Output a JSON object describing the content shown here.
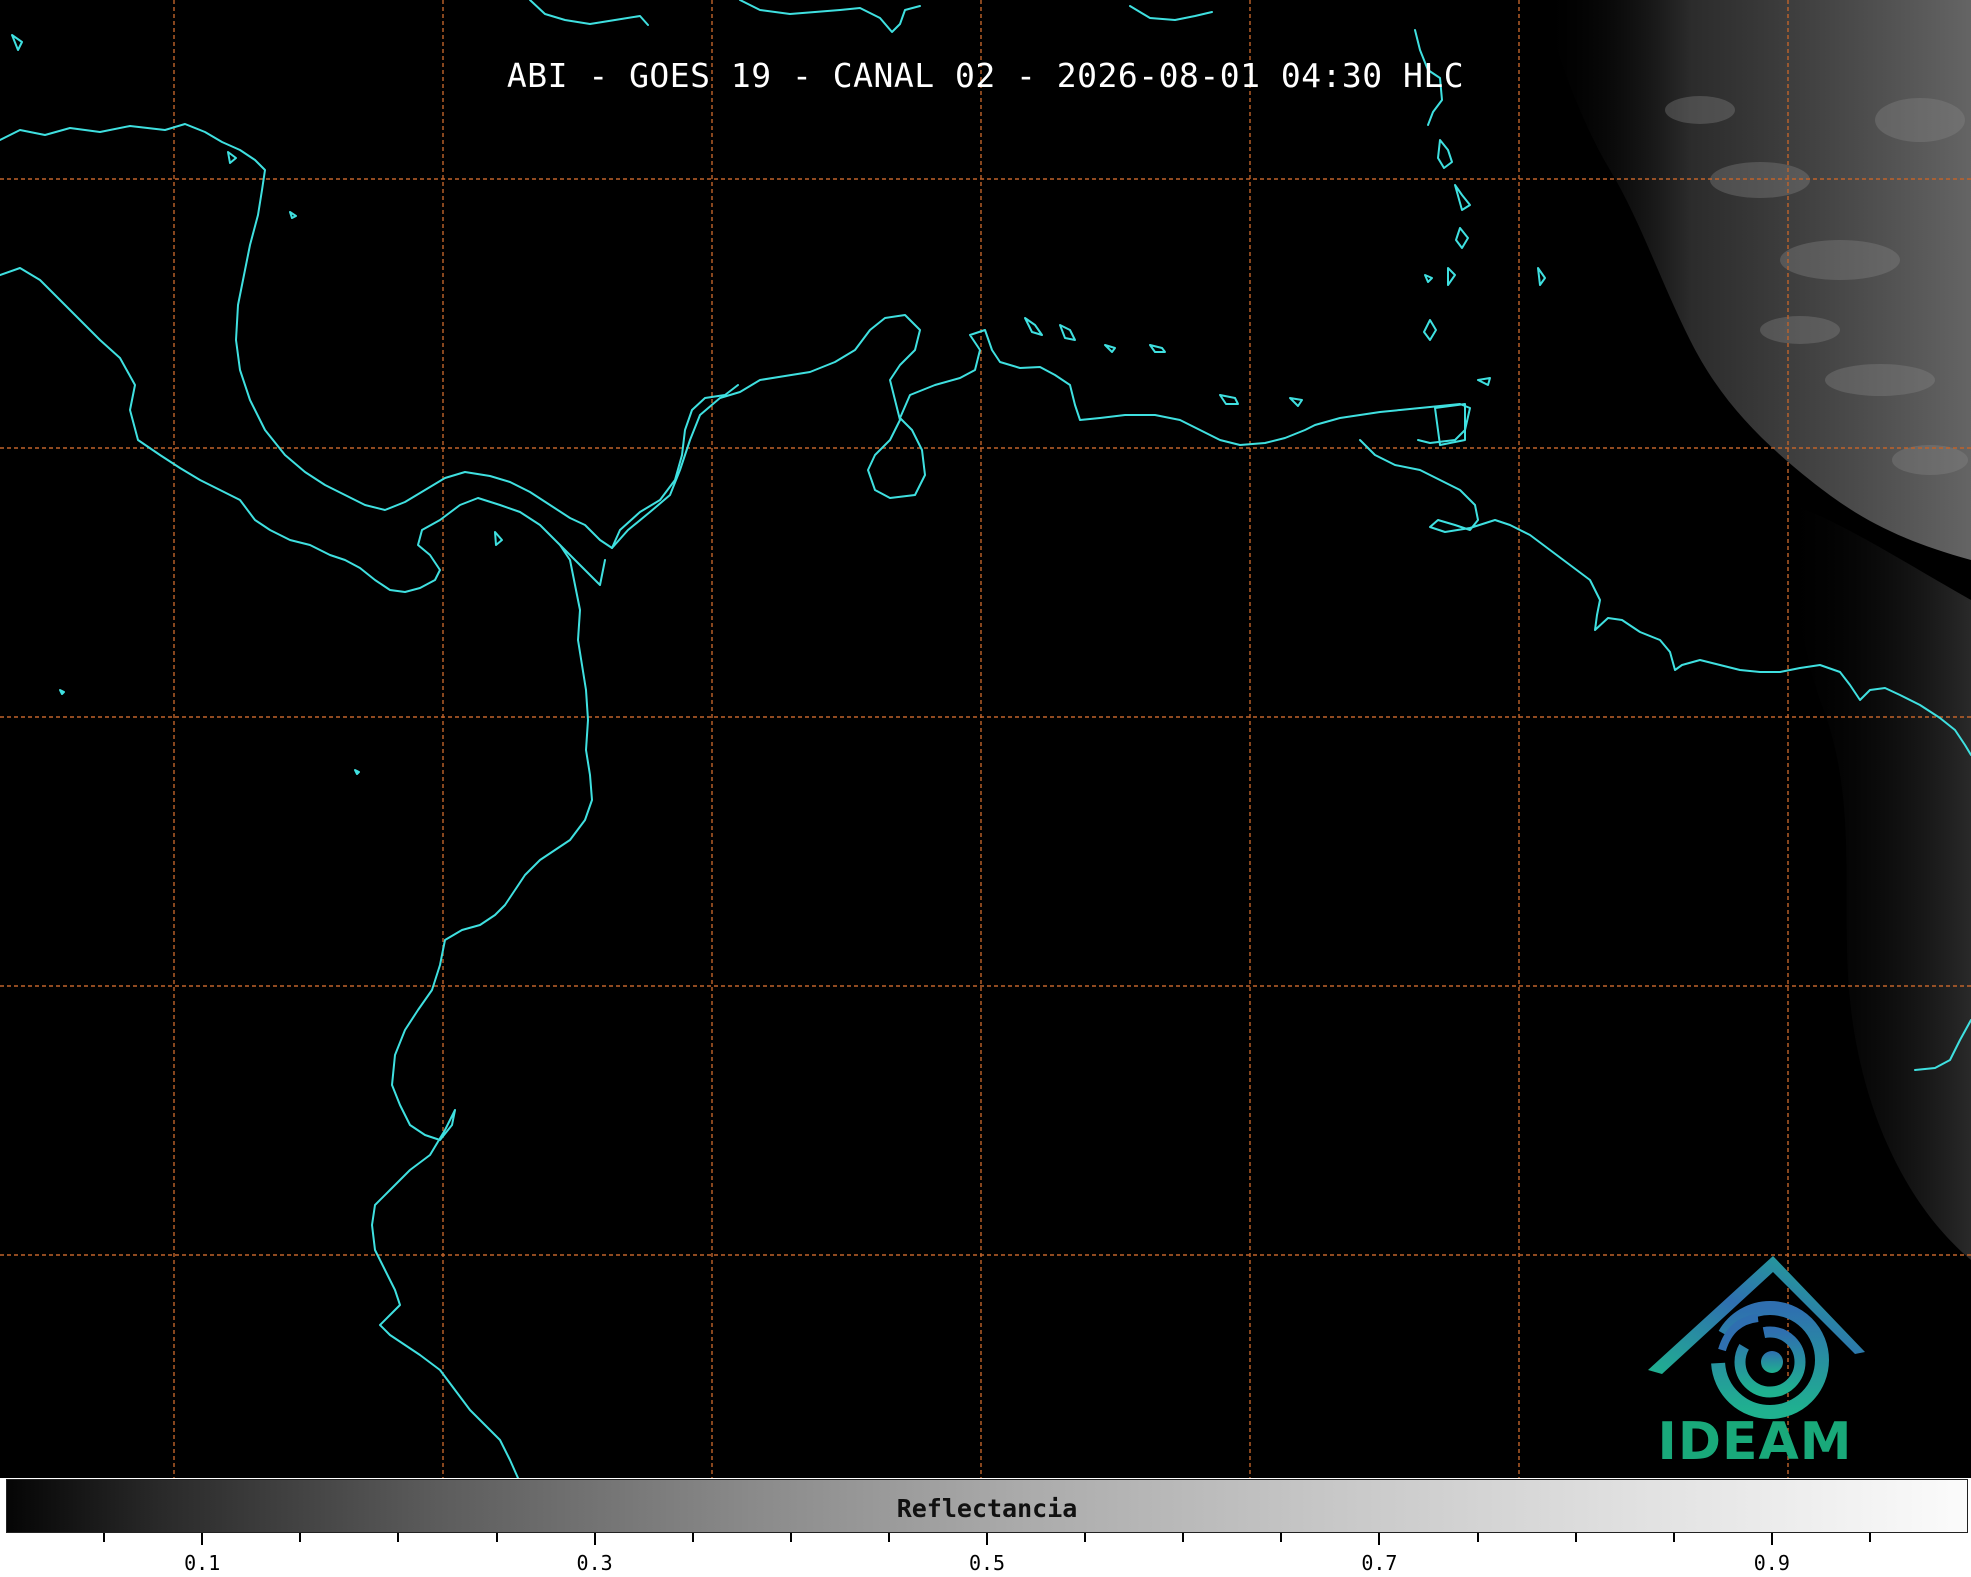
{
  "title": "ABI - GOES 19 - CANAL 02 - 2026-08-01 04:30 HLC",
  "colorbar": {
    "label": "Reflectancia",
    "range": [
      0.0,
      1.0
    ],
    "ticks": [
      "0.1",
      "0.3",
      "0.5",
      "0.7",
      "0.9"
    ],
    "colormap": [
      "#050505",
      "#fbfbfb"
    ]
  },
  "logo": {
    "text": "IDEAM",
    "colors": {
      "roof": "#2f6fb0",
      "swirl": "#1fb28f",
      "text": "#19a97a"
    }
  },
  "map": {
    "background": "#000000",
    "coastline_color": "#3fe0e0",
    "grid_color": "#c0632a"
  }
}
